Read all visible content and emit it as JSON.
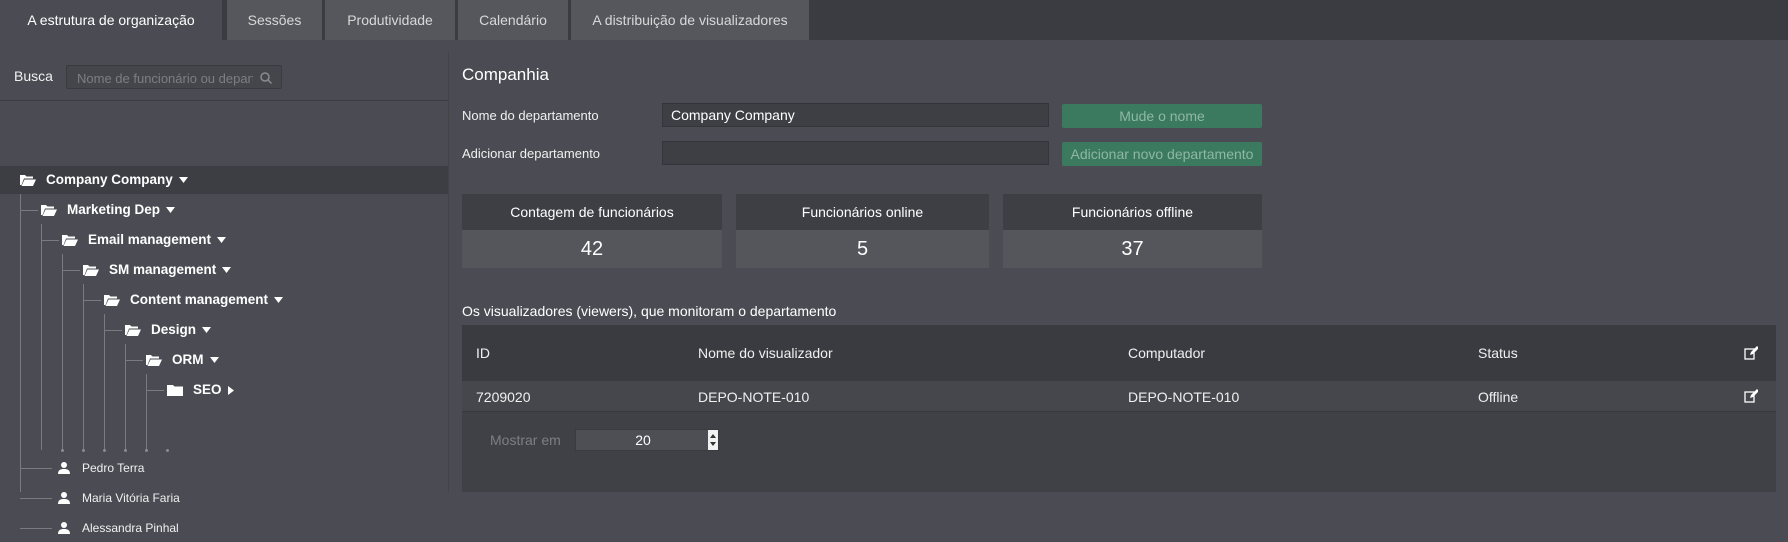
{
  "tabs": [
    {
      "label": "A estrutura de organização",
      "active": true
    },
    {
      "label": "Sessões",
      "active": false
    },
    {
      "label": "Produtividade",
      "active": false
    },
    {
      "label": "Calendário",
      "active": false
    },
    {
      "label": "A distribuição de visualizadores",
      "active": false
    }
  ],
  "search": {
    "label": "Busca",
    "placeholder": "Nome de funcionário ou departamento"
  },
  "tree": {
    "departments": [
      {
        "name": "Company Company",
        "expanded": true
      },
      {
        "name": "Marketing Dep",
        "expanded": true
      },
      {
        "name": "Email management",
        "expanded": true
      },
      {
        "name": "SM management",
        "expanded": true
      },
      {
        "name": "Content management",
        "expanded": true
      },
      {
        "name": "Design",
        "expanded": true
      },
      {
        "name": "ORM",
        "expanded": true
      },
      {
        "name": "SEO",
        "expanded": false
      }
    ],
    "employees": [
      "Pedro Terra",
      "Maria Vitória Faria",
      "Alessandra Pinhal"
    ]
  },
  "company": {
    "title": "Companhia",
    "dept_name_label": "Nome do departamento",
    "dept_name_value": "Company Company",
    "rename_button": "Mude o nome",
    "add_dept_label": "Adicionar departamento",
    "add_dept_value": "",
    "add_dept_button": "Adicionar novo departamento"
  },
  "stats": [
    {
      "label": "Contagem de funcionários",
      "value": "42"
    },
    {
      "label": "Funcionários online",
      "value": "5"
    },
    {
      "label": "Funcionários offline",
      "value": "37"
    }
  ],
  "viewers": {
    "title": "Os visualizadores (viewers), que monitoram o departamento",
    "columns": [
      "ID",
      "Nome do visualizador",
      "Computador",
      "Status"
    ],
    "rows": [
      {
        "id": "7209020",
        "name": "DEPO-NOTE-010",
        "computer": "DEPO-NOTE-010",
        "status": "Offline"
      }
    ],
    "show_label": "Mostrar em",
    "page_size": "20"
  },
  "colors": {
    "background": "#4b4c53",
    "accent_green": "#3b7a5e",
    "header_dark": "#3a3b41"
  }
}
